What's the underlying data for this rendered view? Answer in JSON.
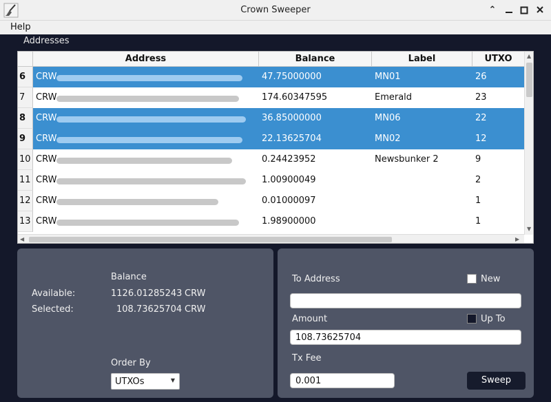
{
  "window": {
    "title": "Crown Sweeper"
  },
  "menu": {
    "help": "Help"
  },
  "addresses": {
    "section_label": "Addresses",
    "columns": [
      "Address",
      "Balance",
      "Label",
      "UTXO"
    ],
    "rows": [
      {
        "num": "6",
        "address": "CRW",
        "balance": "47.75000000",
        "label": "MN01",
        "utxo": "26",
        "selected": true
      },
      {
        "num": "7",
        "address": "CRW",
        "balance": "174.60347595",
        "label": "Emerald",
        "utxo": "23",
        "selected": false
      },
      {
        "num": "8",
        "address": "CRW",
        "balance": "36.85000000",
        "label": "MN06",
        "utxo": "22",
        "selected": true
      },
      {
        "num": "9",
        "address": "CRW",
        "balance": "22.13625704",
        "label": "MN02",
        "utxo": "12",
        "selected": true
      },
      {
        "num": "10",
        "address": "CRW",
        "balance": "0.24423952",
        "label": "Newsbunker 2",
        "utxo": "9",
        "selected": false
      },
      {
        "num": "11",
        "address": "CRW",
        "balance": "1.00900049",
        "label": "",
        "utxo": "2",
        "selected": false
      },
      {
        "num": "12",
        "address": "CRW",
        "balance": "0.01000097",
        "label": "",
        "utxo": "1",
        "selected": false
      },
      {
        "num": "13",
        "address": "CRW",
        "balance": "1.98900000",
        "label": "",
        "utxo": "1",
        "selected": false
      }
    ]
  },
  "balance": {
    "heading": "Balance",
    "available_label": "Available:",
    "available_value": "1126.01285243",
    "selected_label": "Selected:",
    "selected_value": "108.73625704",
    "unit": "CRW",
    "order_by_label": "Order By",
    "order_by_value": "UTXOs"
  },
  "send": {
    "to_address_label": "To Address",
    "to_address_value": "",
    "new_label": "New",
    "new_checked": false,
    "amount_label": "Amount",
    "amount_value": "108.73625704",
    "up_to_label": "Up To",
    "up_to_checked": false,
    "tx_fee_label": "Tx Fee",
    "tx_fee_value": "0.001",
    "sweep_label": "Sweep"
  },
  "colors": {
    "selected_row": "#3b8fd0",
    "panel": "#4f5566",
    "background": "#14182a"
  }
}
